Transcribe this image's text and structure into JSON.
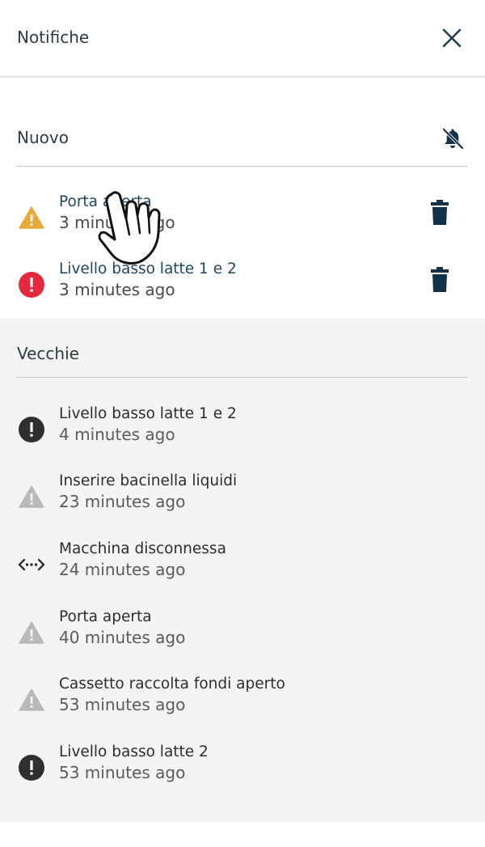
{
  "header": {
    "title": "Notifiche"
  },
  "sections": {
    "new": {
      "title": "Nuovo",
      "items": [
        {
          "title": "Porta aperta",
          "time": "3 minutes ago",
          "icon": "warning-icon"
        },
        {
          "title": "Livello basso latte 1 e 2",
          "time": "3 minutes ago",
          "icon": "error-icon"
        }
      ]
    },
    "old": {
      "title": "Vecchie",
      "items": [
        {
          "title": "Livello basso latte 1 e 2",
          "time": "4 minutes ago",
          "icon": "error-icon"
        },
        {
          "title": "Inserire bacinella liquidi",
          "time": "23 minutes ago",
          "icon": "warning-icon"
        },
        {
          "title": "Macchina disconnessa",
          "time": "24 minutes ago",
          "icon": "disconnected-icon"
        },
        {
          "title": "Porta aperta",
          "time": "40 minutes ago",
          "icon": "warning-icon"
        },
        {
          "title": "Cassetto raccolta fondi aperto",
          "time": "53 minutes ago",
          "icon": "warning-icon"
        },
        {
          "title": "Livello basso latte 2",
          "time": "53 minutes ago",
          "icon": "error-icon"
        }
      ]
    }
  },
  "colors": {
    "warning_new": "#e9a83a",
    "error_new": "#e5283d",
    "title_new": "#1e4763",
    "trash": "#14324a",
    "old_background": "#f4f4f4",
    "icon_old_error": "#2f2f2f",
    "icon_old_warning": "#b9b9b9"
  }
}
